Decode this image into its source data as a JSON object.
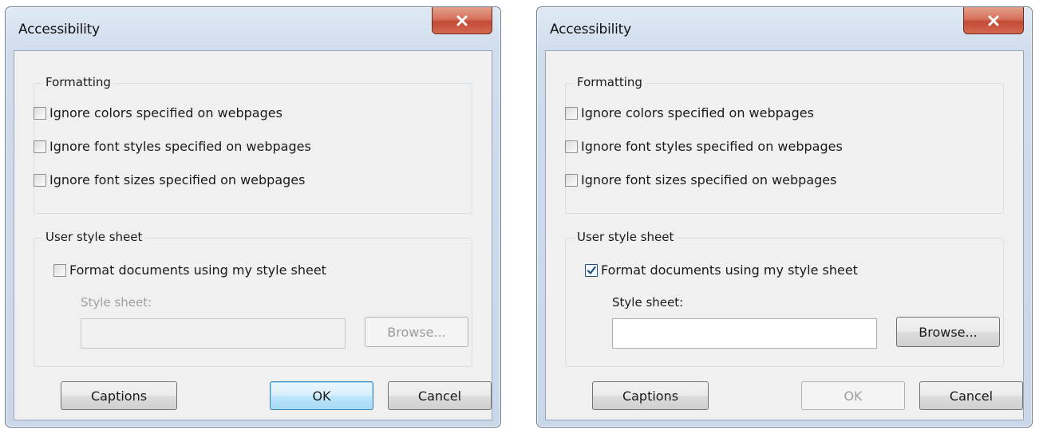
{
  "dialogs": [
    {
      "title": "Accessibility",
      "formatting": {
        "label": "Formatting",
        "options": [
          {
            "label": "Ignore colors specified on webpages",
            "checked": false
          },
          {
            "label": "Ignore font styles specified on webpages",
            "checked": false
          },
          {
            "label": "Ignore font sizes specified on webpages",
            "checked": false
          }
        ]
      },
      "user_style_sheet": {
        "label": "User style sheet",
        "format_option": {
          "label": "Format documents using my style sheet",
          "checked": false
        },
        "style_sheet_label": "Style sheet:",
        "style_sheet_value": "",
        "browse_label": "Browse...",
        "enabled": false
      },
      "buttons": {
        "captions": "Captions",
        "ok": "OK",
        "cancel": "Cancel",
        "ok_enabled": true
      }
    },
    {
      "title": "Accessibility",
      "formatting": {
        "label": "Formatting",
        "options": [
          {
            "label": "Ignore colors specified on webpages",
            "checked": false
          },
          {
            "label": "Ignore font styles specified on webpages",
            "checked": false
          },
          {
            "label": "Ignore font sizes specified on webpages",
            "checked": false
          }
        ]
      },
      "user_style_sheet": {
        "label": "User style sheet",
        "format_option": {
          "label": "Format documents using my style sheet",
          "checked": true
        },
        "style_sheet_label": "Style sheet:",
        "style_sheet_value": "",
        "browse_label": "Browse...",
        "enabled": true
      },
      "buttons": {
        "captions": "Captions",
        "ok": "OK",
        "cancel": "Cancel",
        "ok_enabled": false
      }
    }
  ],
  "icons": {
    "close": "close-icon",
    "checkmark": "checkmark-icon"
  },
  "colors": {
    "close_button": "#c8503a",
    "default_button_border": "#3c7fb1",
    "checkmark": "#1c5180"
  }
}
